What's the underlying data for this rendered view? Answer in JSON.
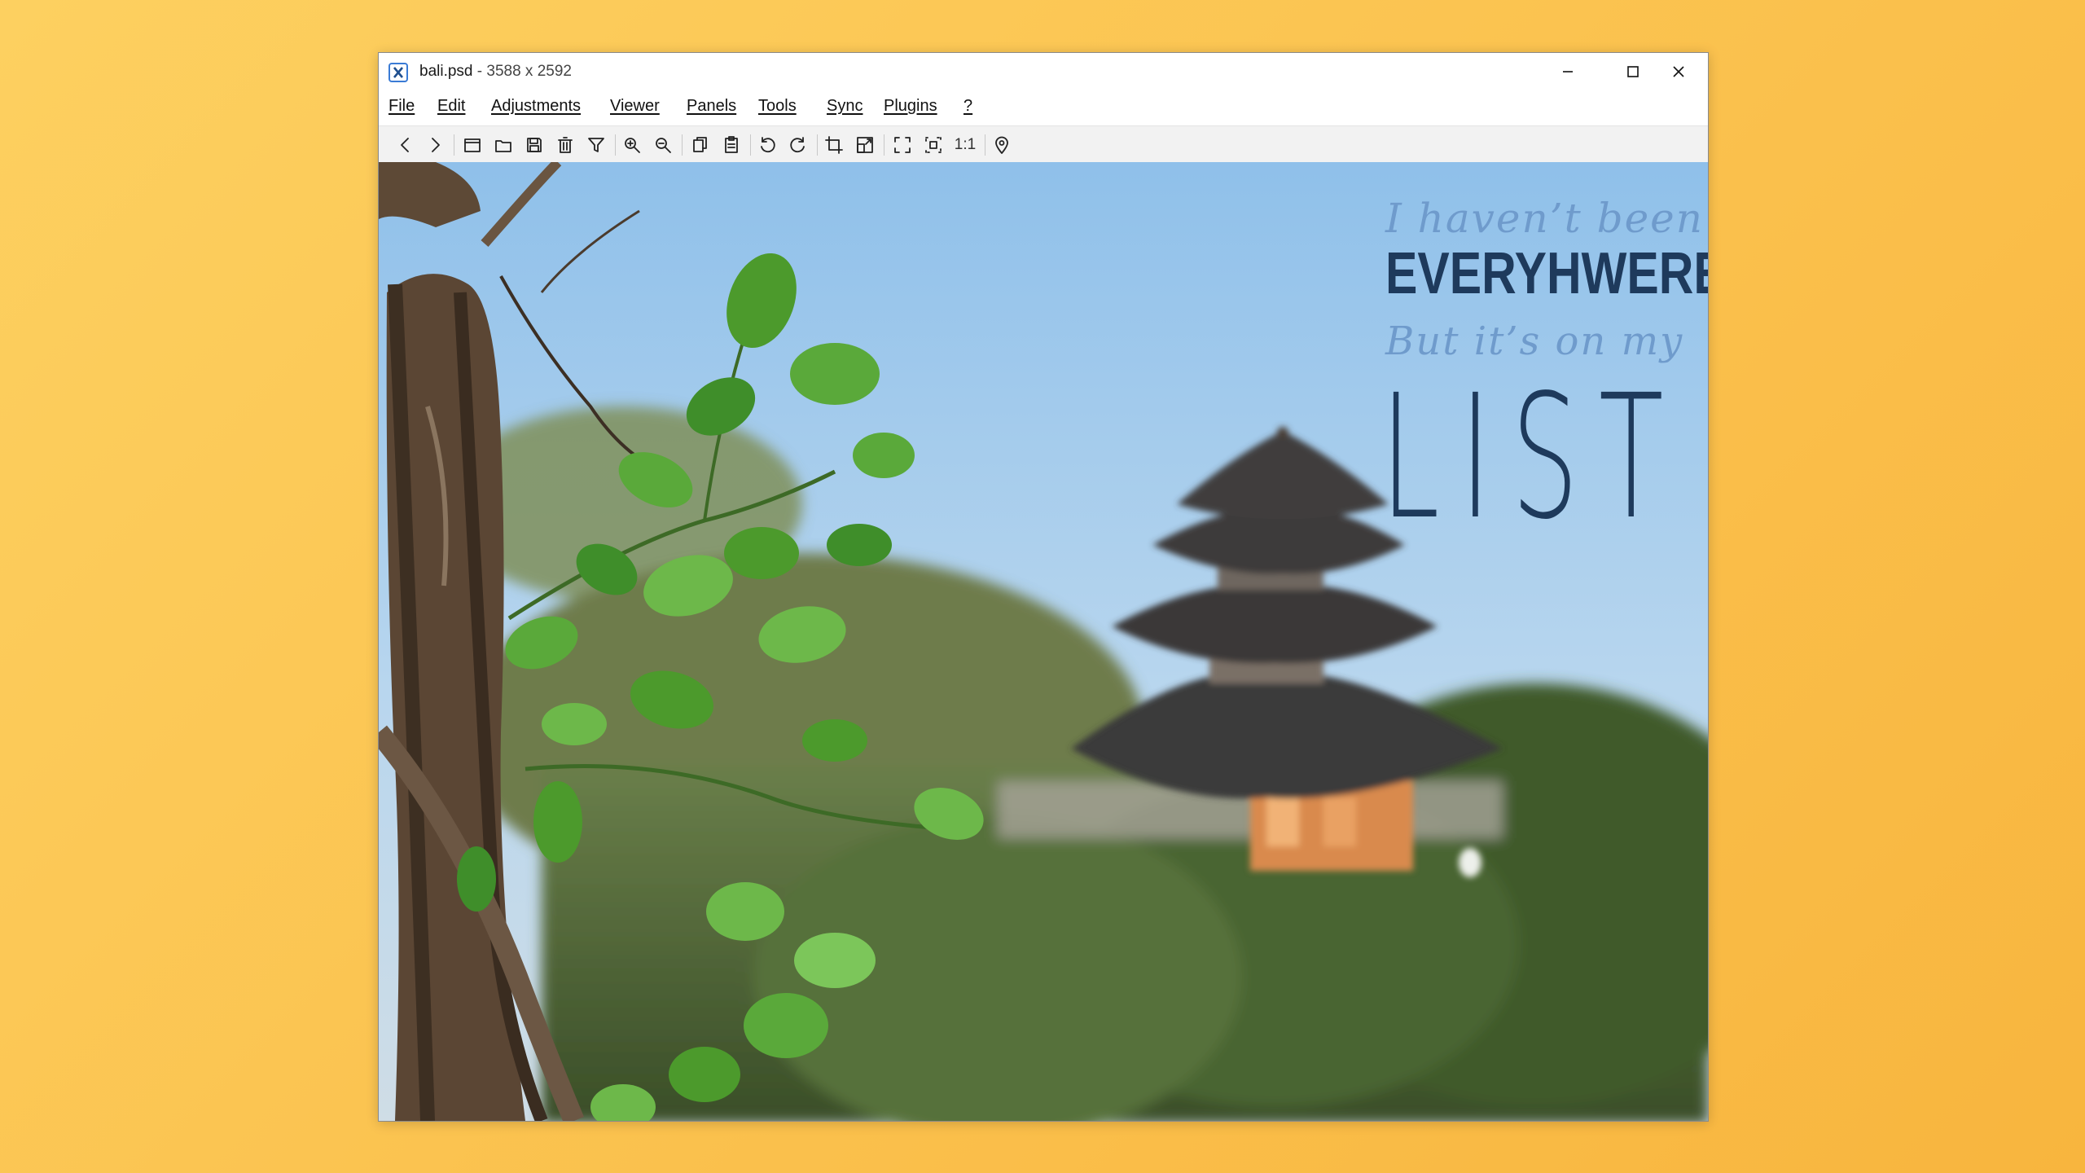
{
  "window": {
    "title": "bali.psd",
    "dimensions": "- 3588 x 2592",
    "icon": "xnview-app-icon"
  },
  "menu": [
    {
      "label": "File"
    },
    {
      "label": "Edit"
    },
    {
      "label": "Adjustments"
    },
    {
      "label": "Viewer"
    },
    {
      "label": "Panels"
    },
    {
      "label": "Tools"
    },
    {
      "label": "Sync"
    },
    {
      "label": "Plugins"
    },
    {
      "label": "?"
    }
  ],
  "toolbar": {
    "icons": [
      "back-icon",
      "forward-icon",
      "browser-icon",
      "open-folder-icon",
      "save-icon",
      "delete-icon",
      "filter-icon",
      "zoom-in-icon",
      "zoom-out-icon",
      "copy-icon",
      "paste-icon",
      "rotate-left-icon",
      "rotate-right-icon",
      "crop-icon",
      "resize-icon",
      "fullscreen-icon",
      "fit-icon",
      "map-pin-icon"
    ],
    "actual_size_label": "1:1"
  },
  "image": {
    "description_icon": "bali-temple-photo",
    "quote": {
      "line1": "I haven’t been",
      "line2": "EVERYHWERE",
      "line3": "But it’s on my",
      "line4": "LIST"
    }
  },
  "colors": {
    "background": "#fbc451",
    "quote_dark": "#1e3a5c",
    "quote_light": "#6f9bcc"
  }
}
